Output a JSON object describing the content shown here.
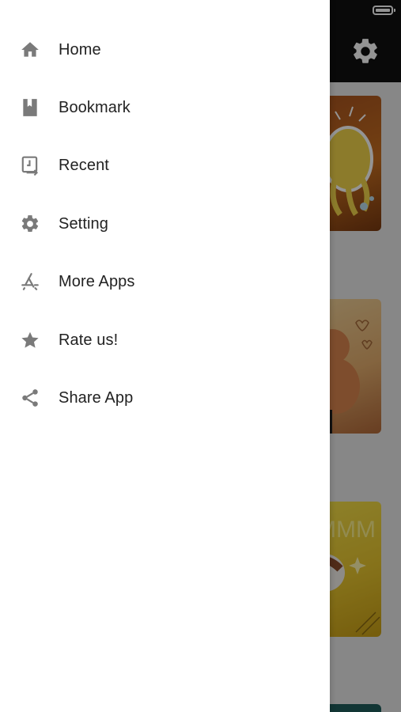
{
  "status_bar": {
    "battery_icon": "battery-icon"
  },
  "app": {
    "settings_icon": "gear-icon",
    "cards": [
      "octopus-sticker-card",
      "bear-sticker-card",
      "mmm-sticker-card",
      "teal-card"
    ]
  },
  "drawer": {
    "items": [
      {
        "label": "Home",
        "icon": "home-icon"
      },
      {
        "label": "Bookmark",
        "icon": "bookmark-icon"
      },
      {
        "label": "Recent",
        "icon": "recent-icon"
      },
      {
        "label": "Setting",
        "icon": "gear-icon"
      },
      {
        "label": "More Apps",
        "icon": "app-store-icon"
      },
      {
        "label": "Rate us!",
        "icon": "star-icon"
      },
      {
        "label": "Share App",
        "icon": "share-icon"
      }
    ]
  },
  "colors": {
    "drawer_bg": "#ffffff",
    "icon_gray": "#7a7a7a",
    "text": "#222222",
    "topbar": "#111111"
  }
}
